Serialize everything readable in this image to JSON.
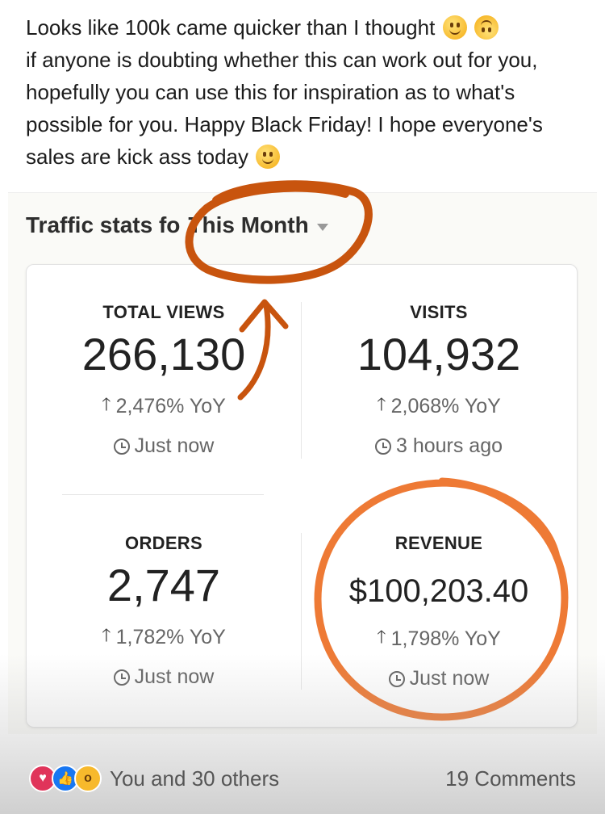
{
  "post": {
    "line1": "Looks like 100k came quicker than I thought",
    "line2": "if anyone is doubting whether this can work out for you, hopefully you can use this for inspiration as to what's possible for you. Happy Black Friday! I hope everyone's sales are kick ass today",
    "emojis": [
      "slightly-smiling-face-icon",
      "upside-down-face-icon",
      "slightly-smiling-face-icon"
    ]
  },
  "stats": {
    "header_prefix": "Traffic stats fo",
    "header_period": "This Month",
    "total_views": {
      "label": "TOTAL VIEWS",
      "value": "266,130",
      "yoy": "2,476% YoY",
      "time": "Just now"
    },
    "visits": {
      "label": "VISITS",
      "value": "104,932",
      "yoy": "2,068% YoY",
      "time": "3 hours ago"
    },
    "orders": {
      "label": "ORDERS",
      "value": "2,747",
      "yoy": "1,782% YoY",
      "time": "Just now"
    },
    "revenue": {
      "label": "REVENUE",
      "value": "$100,203.40",
      "yoy": "1,798% YoY",
      "time": "Just now"
    }
  },
  "footer": {
    "reactions_text": "You and 30 others",
    "comments_text": "19 Comments",
    "reaction_icons": [
      "love-icon",
      "like-icon",
      "wow-icon"
    ]
  },
  "colors": {
    "annotation_dark": "#c8540e",
    "annotation_light": "#ee7a35"
  }
}
